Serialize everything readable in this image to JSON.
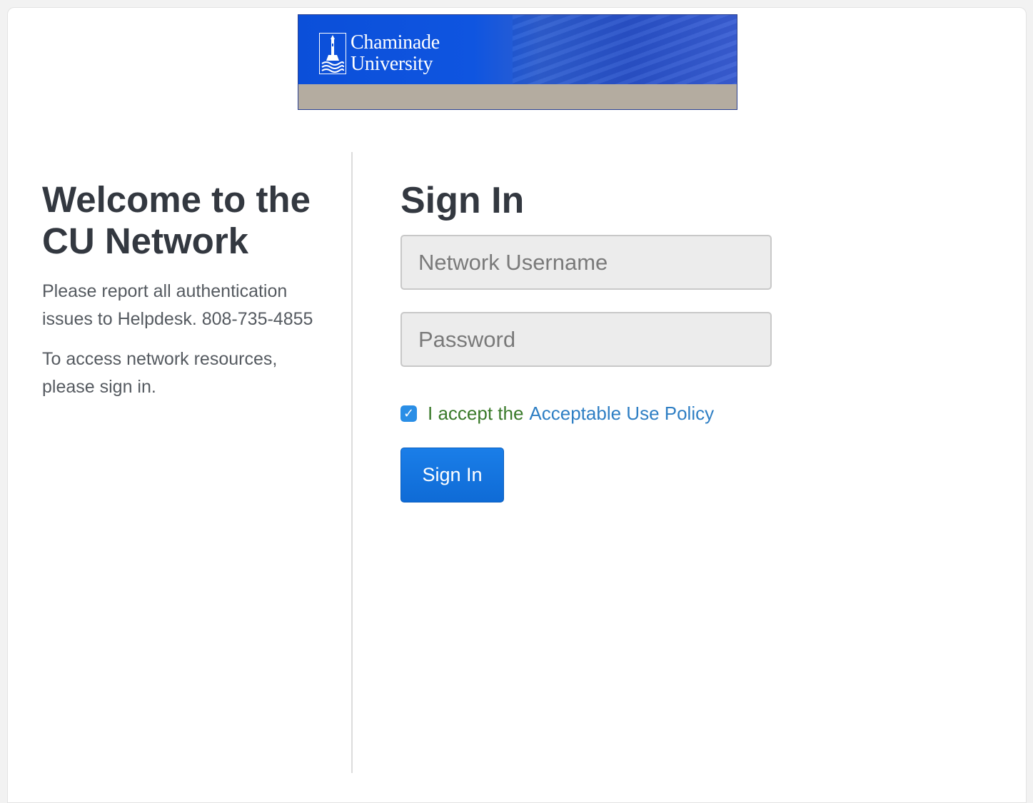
{
  "banner": {
    "logo_line1": "Chaminade",
    "logo_line2": "University"
  },
  "welcome": {
    "title_line1": "Welcome to the",
    "title_line2": "CU Network",
    "report_text": "Please report all authentication issues to Helpdesk. 808-735-4855",
    "access_text": "To access network resources, please sign in."
  },
  "signin": {
    "title": "Sign In",
    "username_placeholder": "Network Username",
    "username_value": "",
    "password_placeholder": "Password",
    "password_value": "",
    "accept_checked": true,
    "accept_prefix": "I accept the",
    "aup_link": "Acceptable Use Policy",
    "button_label": "Sign In"
  },
  "colors": {
    "banner_blue": "#0b4fd9",
    "banner_tan": "#b4aca0",
    "button_blue": "#1a7ee8",
    "accept_green": "#3a7a2a",
    "link_blue": "#2f7fc4"
  }
}
